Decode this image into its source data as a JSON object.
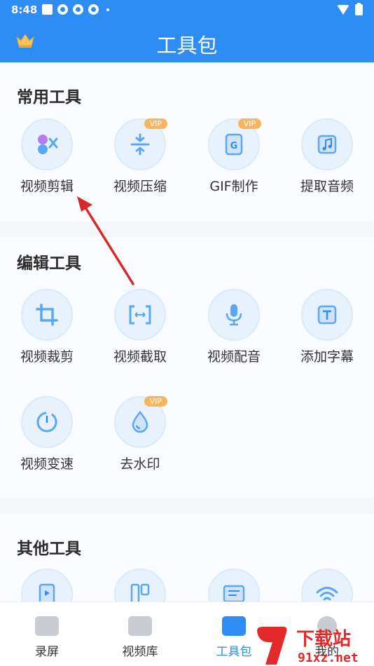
{
  "status": {
    "time": "8:48"
  },
  "header": {
    "title": "工具包"
  },
  "sections": [
    {
      "title": "常用工具",
      "tools": [
        {
          "label": "视频剪辑",
          "icon": "video-edit-icon",
          "vip": false
        },
        {
          "label": "视频压缩",
          "icon": "compress-icon",
          "vip": true
        },
        {
          "label": "GIF制作",
          "icon": "gif-icon",
          "vip": true
        },
        {
          "label": "提取音频",
          "icon": "music-note-icon",
          "vip": false
        }
      ]
    },
    {
      "title": "编辑工具",
      "tools": [
        {
          "label": "视频裁剪",
          "icon": "crop-icon",
          "vip": false
        },
        {
          "label": "视频截取",
          "icon": "trim-icon",
          "vip": false
        },
        {
          "label": "视频配音",
          "icon": "microphone-icon",
          "vip": false
        },
        {
          "label": "添加字幕",
          "icon": "text-icon",
          "vip": false
        },
        {
          "label": "视频变速",
          "icon": "speed-icon",
          "vip": false
        },
        {
          "label": "去水印",
          "icon": "water-drop-icon",
          "vip": true
        }
      ]
    },
    {
      "title": "其他工具",
      "tools": [
        {
          "icon": "video-file-icon"
        },
        {
          "icon": "split-icon"
        },
        {
          "icon": "document-icon"
        },
        {
          "icon": "wifi-icon"
        }
      ]
    }
  ],
  "vip_label": "VIP",
  "tabs": [
    {
      "label": "录屏",
      "icon": "camera-icon",
      "active": false
    },
    {
      "label": "视频库",
      "icon": "folder-video-icon",
      "active": false
    },
    {
      "label": "工具包",
      "icon": "toolbox-icon",
      "active": true
    },
    {
      "label": "我的",
      "icon": "user-icon",
      "active": false
    }
  ],
  "watermark": {
    "text": "下载站",
    "domain": "91xz.net"
  },
  "colors": {
    "primary": "#2e8cf5",
    "vip": "#f7b45a",
    "arrow": "#d62a2a"
  }
}
